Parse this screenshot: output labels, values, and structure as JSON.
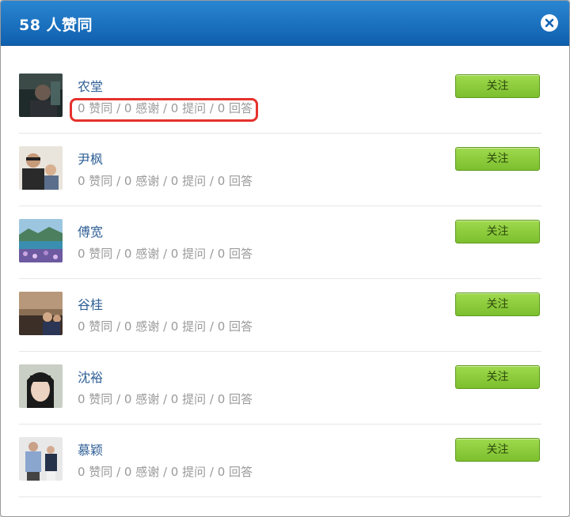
{
  "dialog": {
    "title": "58 人赞同",
    "close_icon": "close-circle-icon"
  },
  "users": [
    {
      "name": "农堂",
      "stats": "0 赞同 / 0 感谢 / 0 提问 / 0 回答",
      "follow_label": "关注",
      "highlighted": true
    },
    {
      "name": "尹枫",
      "stats": "0 赞同 / 0 感谢 / 0 提问 / 0 回答",
      "follow_label": "关注"
    },
    {
      "name": "傅宽",
      "stats": "0 赞同 / 0 感谢 / 0 提问 / 0 回答",
      "follow_label": "关注"
    },
    {
      "name": "谷桂",
      "stats": "0 赞同 / 0 感谢 / 0 提问 / 0 回答",
      "follow_label": "关注"
    },
    {
      "name": "沈裕",
      "stats": "0 赞同 / 0 感谢 / 0 提问 / 0 回答",
      "follow_label": "关注"
    },
    {
      "name": "慕颖",
      "stats": "0 赞同 / 0 感谢 / 0 提问 / 0 回答",
      "follow_label": "关注"
    }
  ],
  "colors": {
    "header": "#1a6fc0",
    "follow_button": "#8cc63f",
    "highlight": "#e5322d",
    "name_link": "#2f5f96"
  }
}
